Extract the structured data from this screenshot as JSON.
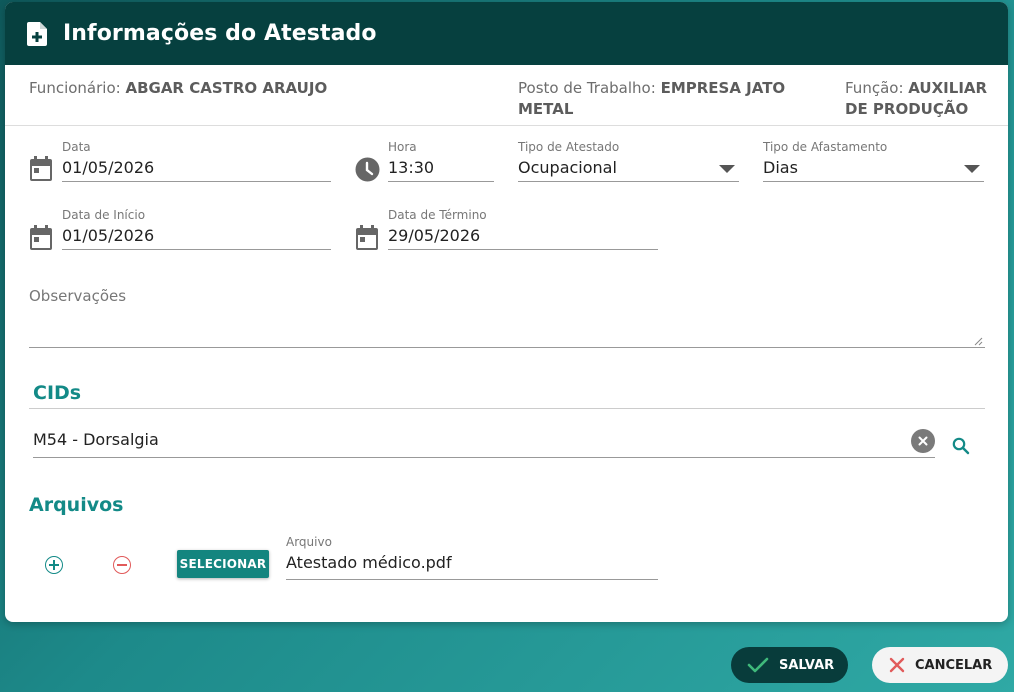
{
  "dialog": {
    "title": "Informações do Atestado",
    "title_icon": "document-plus-icon"
  },
  "info": {
    "employee_label": "Funcionário:",
    "employee_value": "ABGAR CASTRO ARAUJO",
    "post_label": "Posto de Trabalho:",
    "post_value_line1": "EMPRESA JATO",
    "post_value_line2": "METAL",
    "role_label": "Função:",
    "role_value_line1": "AUXILIAR",
    "role_value_line2": "DE PRODUÇÃO"
  },
  "form": {
    "date": {
      "label": "Data",
      "value": "01/05/2026",
      "icon": "calendar-icon"
    },
    "time": {
      "label": "Hora",
      "value": "13:30",
      "icon": "clock-icon"
    },
    "cert_type": {
      "label": "Tipo de Atestado",
      "value": "Ocupacional"
    },
    "leave_type": {
      "label": "Tipo de Afastamento",
      "value": "Dias"
    },
    "start_date": {
      "label": "Data de Início",
      "value": "01/05/2026",
      "icon": "calendar-icon"
    },
    "end_date": {
      "label": "Data de Término",
      "value": "29/05/2026",
      "icon": "calendar-icon"
    },
    "notes": {
      "label": "Observações",
      "value": ""
    }
  },
  "cids": {
    "title": "CIDs",
    "value": "M54 - Dorsalgia"
  },
  "files": {
    "title": "Arquivos",
    "select_label": "SELECIONAR",
    "file_label": "Arquivo",
    "file_value": "Atestado médico.pdf"
  },
  "footer": {
    "save_label": "SALVAR",
    "cancel_label": "CANCELAR"
  },
  "colors": {
    "header_bg": "#06403f",
    "accent": "#138a87",
    "danger": "#e15a5a"
  }
}
